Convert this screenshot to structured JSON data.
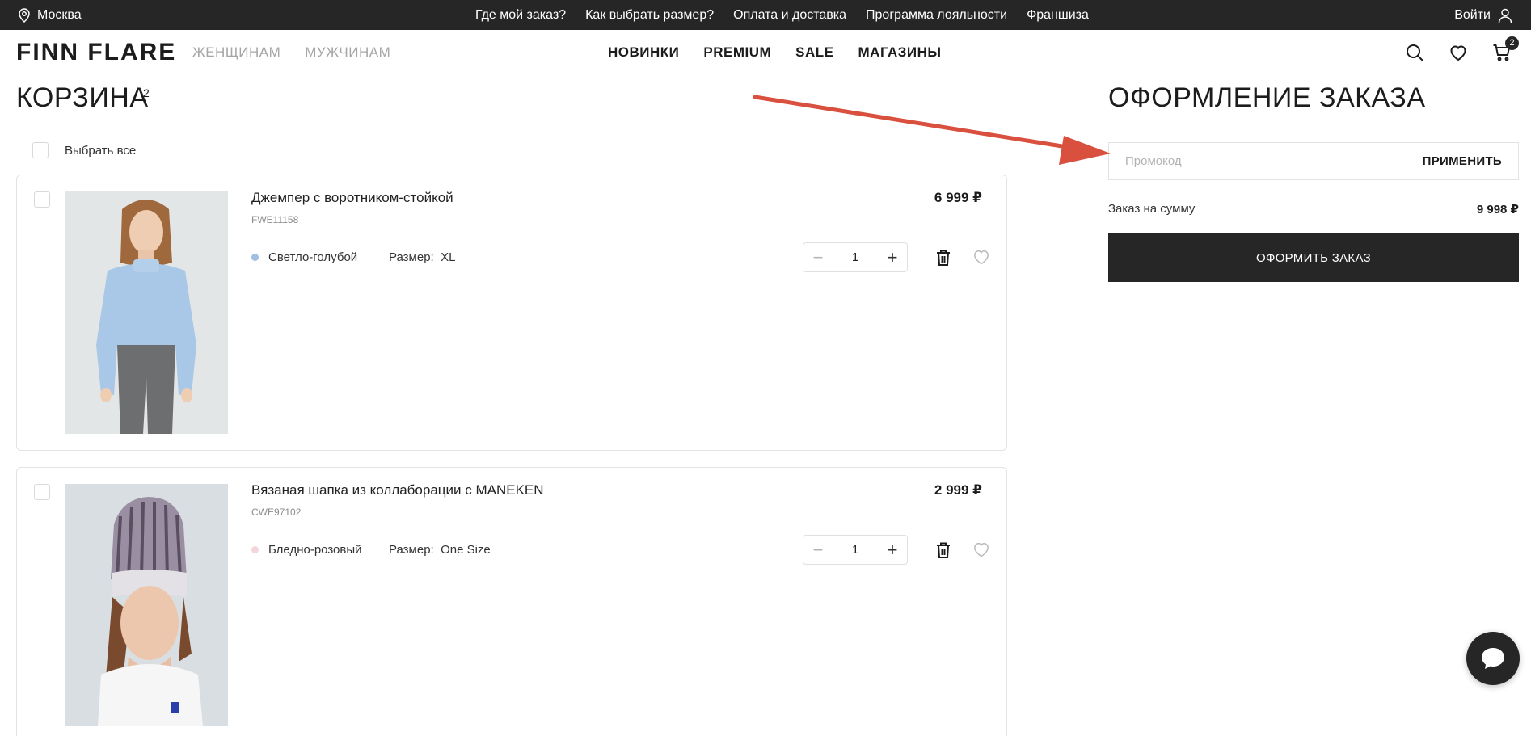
{
  "topbar": {
    "city": "Москва",
    "links": [
      "Где мой заказ?",
      "Как выбрать размер?",
      "Оплата и доставка",
      "Программа лояльности",
      "Франшиза"
    ],
    "login": "Войти"
  },
  "header": {
    "logo": "FINN FLARE",
    "gender_nav": [
      "ЖЕНЩИНАМ",
      "МУЖЧИНАМ"
    ],
    "main_nav": [
      "НОВИНКИ",
      "PREMIUM",
      "SALE",
      "МАГАЗИНЫ"
    ],
    "cart_count": "2"
  },
  "cart": {
    "title": "КОРЗИНА",
    "count": "2",
    "select_all": "Выбрать все",
    "items": [
      {
        "name": "Джемпер с воротником-стойкой",
        "sku": "FWE11158",
        "color_name": "Светло-голубой",
        "color_hex": "#9fbfe3",
        "size_label": "Размер:",
        "size": "XL",
        "price": "6 999 ₽",
        "qty": "1"
      },
      {
        "name": "Вязаная шапка из коллаборации с MANEKEN",
        "sku": "CWE97102",
        "color_name": "Бледно-розовый",
        "color_hex": "#f3d6d9",
        "size_label": "Размер:",
        "size": "One Size",
        "price": "2 999 ₽",
        "qty": "1"
      }
    ]
  },
  "checkout": {
    "title": "ОФОРМЛЕНИЕ ЗАКАЗА",
    "promo_placeholder": "Промокод",
    "apply_label": "ПРИМЕНИТЬ",
    "sum_label": "Заказ на сумму",
    "sum_value": "9 998 ₽",
    "order_button": "ОФОРМИТЬ ЗАКАЗ"
  },
  "colors": {
    "dark": "#262626",
    "muted_nav": "#a6a6a6",
    "annotation_arrow": "#d9503f"
  },
  "icons": {
    "location": "location-pin-icon",
    "user": "user-icon",
    "search": "search-icon",
    "favorites": "heart-icon",
    "cart": "cart-icon",
    "delete": "trash-icon",
    "chat": "chat-icon"
  }
}
